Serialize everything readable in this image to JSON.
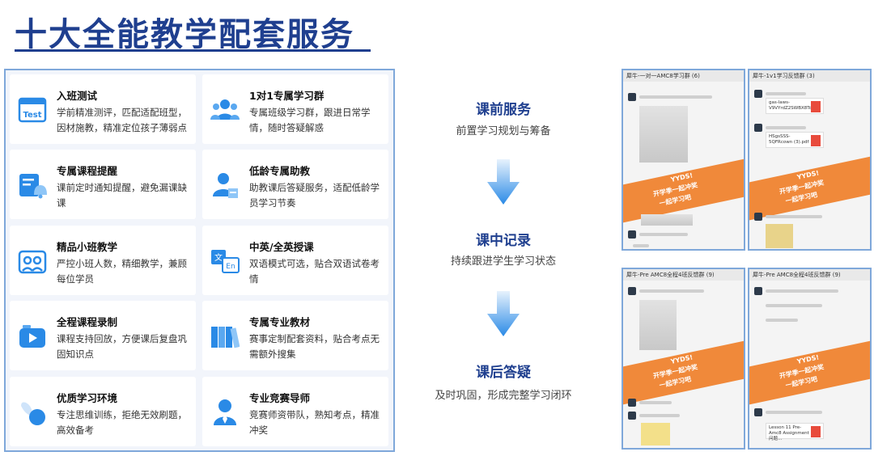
{
  "title": "十大全能教学配套服务",
  "services": [
    {
      "title": "入班测试",
      "desc": "学前精准测评，匹配适配班型，因材施教，精准定位孩子薄弱点",
      "icon": "test-icon"
    },
    {
      "title": "1对1专属学习群",
      "desc": "专属班级学习群，跟进日常学情，随时答疑解惑",
      "icon": "group-icon"
    },
    {
      "title": "专属课程提醒",
      "desc": "课前定时通知提醒，避免漏课缺课",
      "icon": "reminder-bell-icon"
    },
    {
      "title": "低龄专属助教",
      "desc": "助教课后答疑服务，适配低龄学员学习节奏",
      "icon": "assistant-icon"
    },
    {
      "title": "精品小班教学",
      "desc": "严控小班人数，精细教学，兼顾每位学员",
      "icon": "small-class-icon"
    },
    {
      "title": "中英/全英授课",
      "desc": "双语模式可选，贴合双语试卷考情",
      "icon": "translate-icon"
    },
    {
      "title": "全程课程录制",
      "desc": "课程支持回放，方便课后复盘巩固知识点",
      "icon": "video-icon"
    },
    {
      "title": "专属专业教材",
      "desc": "赛事定制配套资料，贴合考点无需额外搜集",
      "icon": "books-icon"
    },
    {
      "title": "优质学习环境",
      "desc": "专注思维训练，拒绝无效刷题，高效备考",
      "icon": "environment-icon"
    },
    {
      "title": "专业竞赛导师",
      "desc": "竞赛师资带队，熟知考点，精准冲奖",
      "icon": "mentor-icon"
    }
  ],
  "flow": [
    {
      "title": "课前服务",
      "sub": "前置学习规划与筹备"
    },
    {
      "title": "课中记录",
      "sub": "持续跟进学生学习状态"
    },
    {
      "title": "课后答疑",
      "sub": "及时巩固，形成完整学习闭环"
    }
  ],
  "screenshots": [
    {
      "header": "犀牛-一对一AMC8学习群 (6)",
      "band_lines": [
        "YYDS!",
        "开学季一起冲奖",
        "一起学习吧"
      ]
    },
    {
      "header": "犀牛-1v1学习反馈群 (3)",
      "band_lines": [
        "YYDS!",
        "开学季一起冲奖",
        "一起学习吧"
      ],
      "files": [
        "gas-laws-V9VYrdZ2SWBX8Tc7.pdf",
        "HSgsSSS-5QFRcown (3).pdf"
      ]
    },
    {
      "header": "犀牛-Pre AMC8全程4班反馈群 (9)",
      "band_lines": [
        "YYDS!",
        "开学季一起冲奖",
        "一起学习吧"
      ]
    },
    {
      "header": "犀牛-Pre AMC8全程4班反馈群 (9)",
      "band_lines": [
        "YYDS!",
        "开学季一起冲奖",
        "一起学习吧"
      ],
      "files": [
        "Lesson 11 Pre-Amc8 Assignment 问题..."
      ]
    }
  ]
}
